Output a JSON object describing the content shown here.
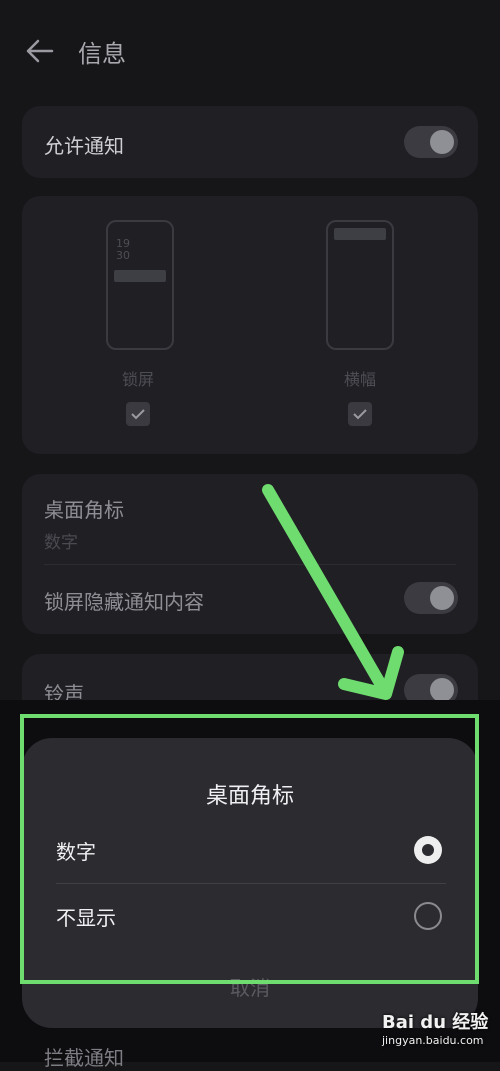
{
  "header": {
    "title": "信息"
  },
  "allow_notification": {
    "label": "允许通知",
    "enabled": true
  },
  "styles": [
    {
      "label": "锁屏",
      "time_hour": "19",
      "time_minute": "30",
      "checked": true
    },
    {
      "label": "横幅",
      "checked": true
    }
  ],
  "settings": {
    "badge_title": "桌面角标",
    "badge_value": "数字",
    "hide_content_label": "锁屏隐藏通知内容",
    "ringtone_label": "铃声",
    "intercept_label": "拦截通知"
  },
  "dialog": {
    "title": "桌面角标",
    "options": [
      {
        "label": "数字",
        "selected": true
      },
      {
        "label": "不显示",
        "selected": false
      }
    ],
    "cancel_label": "取消"
  },
  "watermark": {
    "brand": "Bai du 经验",
    "url": "jingyan.baidu.com"
  },
  "colors": {
    "highlight": "#6fdc6f",
    "arrow": "#6fdc6f"
  }
}
